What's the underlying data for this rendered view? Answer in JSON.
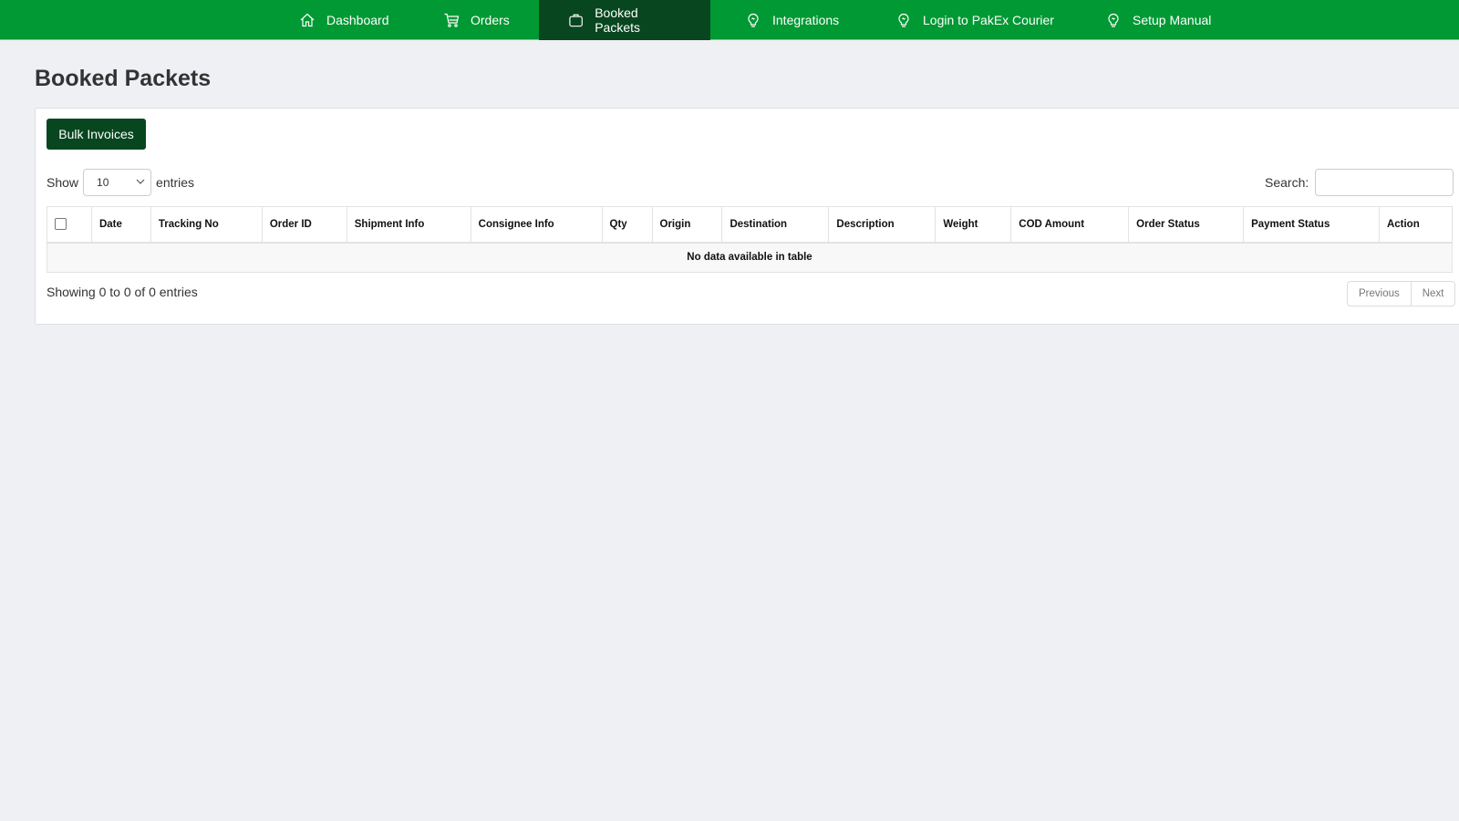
{
  "nav": {
    "items": [
      {
        "label": "Dashboard",
        "icon": "home-icon",
        "active": false
      },
      {
        "label": "Orders",
        "icon": "cart-icon",
        "active": false
      },
      {
        "label": "Booked Packets",
        "icon": "bag-icon",
        "active": true
      },
      {
        "label": "Integrations",
        "icon": "lightbulb-icon",
        "active": false
      },
      {
        "label": "Login to PakEx Courier",
        "icon": "lightbulb-icon",
        "active": false
      },
      {
        "label": "Setup Manual",
        "icon": "lightbulb-icon",
        "active": false
      }
    ],
    "colors": {
      "background": "#009933",
      "active": "#08461f"
    }
  },
  "page": {
    "title": "Booked Packets"
  },
  "toolbar": {
    "bulk_invoices_label": "Bulk Invoices"
  },
  "table_controls": {
    "show_label": "Show",
    "entries_label": "entries",
    "page_length": "10",
    "search_label": "Search:",
    "search_value": ""
  },
  "table": {
    "columns": [
      "Date",
      "Tracking No",
      "Order ID",
      "Shipment Info",
      "Consignee Info",
      "Qty",
      "Origin",
      "Destination",
      "Description",
      "Weight",
      "COD Amount",
      "Order Status",
      "Payment Status",
      "Action"
    ],
    "empty_message": "No data available in table",
    "rows": []
  },
  "footer": {
    "info": "Showing 0 to 0 of 0 entries",
    "previous_label": "Previous",
    "next_label": "Next"
  }
}
